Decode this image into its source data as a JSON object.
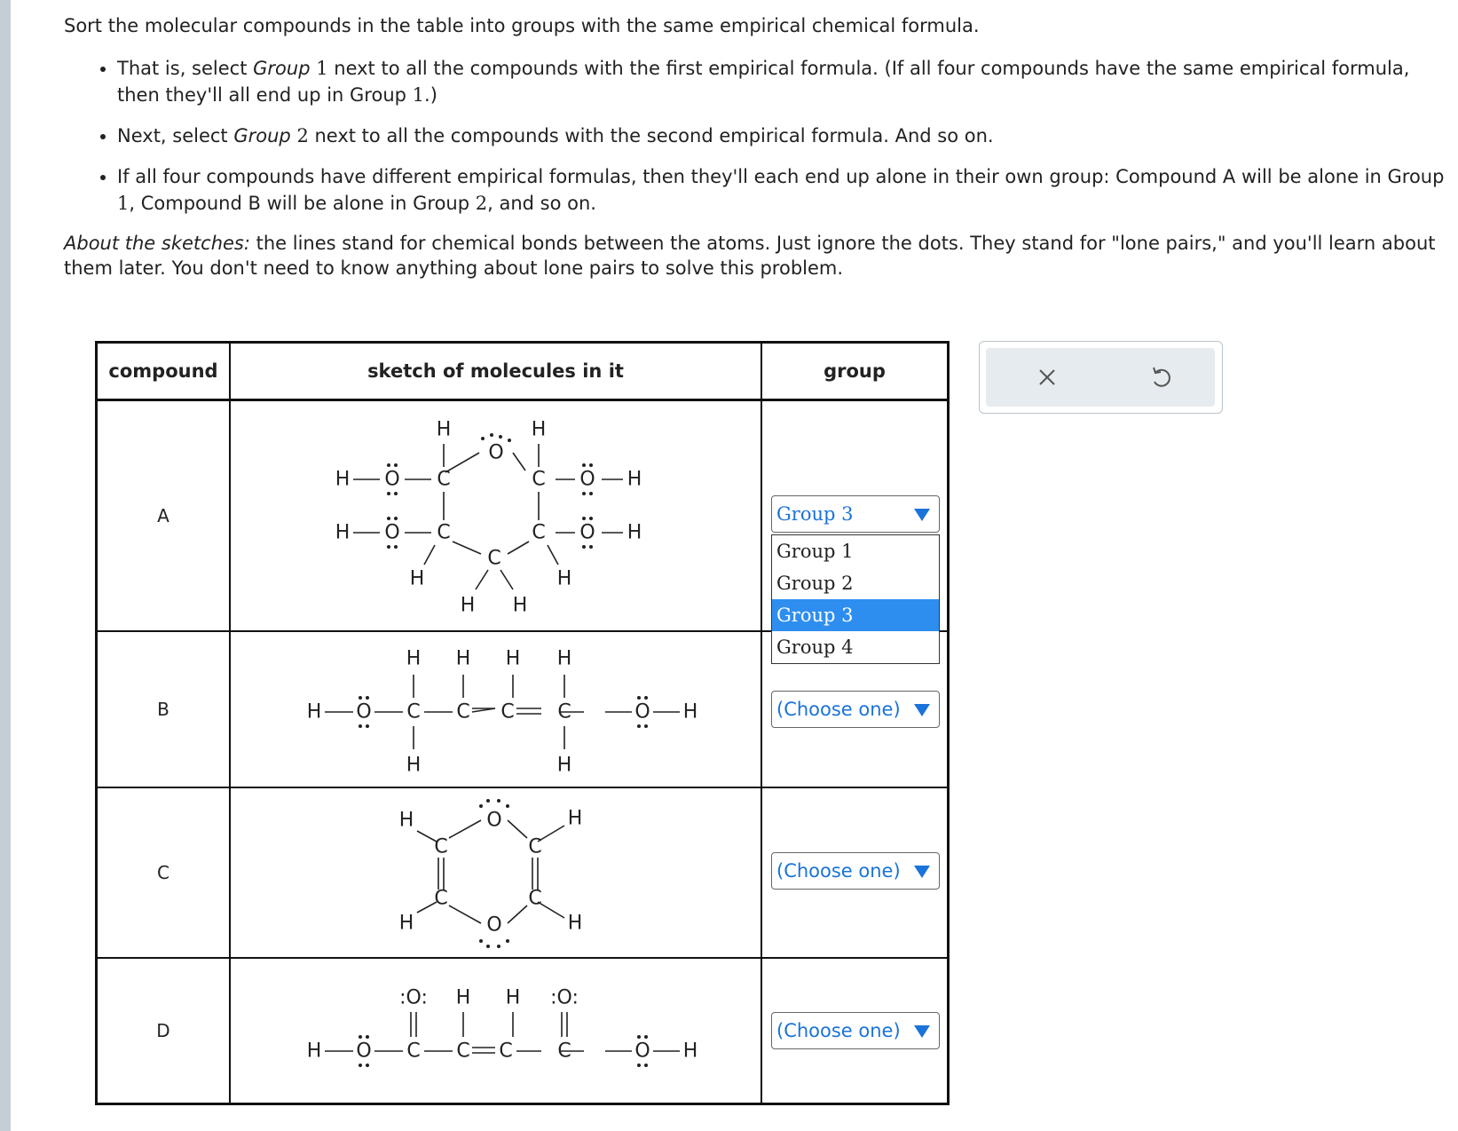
{
  "instructions": {
    "title": "Sort the molecular compounds in the table into groups with the same empirical chemical formula.",
    "bullet1_a": "That is, select ",
    "bullet1_group": "Group",
    "bullet1_num": "1",
    "bullet1_b": " next to all the compounds with the first empirical formula. (If all four compounds have the same empirical formula, then they'll all end up in Group ",
    "bullet1_num2": "1",
    "bullet1_c": ".)",
    "bullet2_a": "Next, select ",
    "bullet2_group": "Group",
    "bullet2_num": "2",
    "bullet2_b": " next to all the compounds with the second empirical formula. And so on.",
    "bullet3_a": "If all four compounds have different empirical formulas, then they'll each end up alone in their own group: Compound A will be alone in Group ",
    "bullet3_num1": "1",
    "bullet3_b": ", Compound B will be alone in Group ",
    "bullet3_num2": "2",
    "bullet3_c": ", and so on.",
    "about_label": "About the sketches:",
    "about_text": " the lines stand for chemical bonds between the atoms. Just ignore the dots. They stand for \"lone pairs,\" and you'll learn about them later. You don't need to know anything about lone pairs to solve this problem."
  },
  "table": {
    "headers": {
      "compound": "compound",
      "sketch": "sketch of molecules in it",
      "group": "group"
    },
    "rows": [
      {
        "compound": "A",
        "selected": "Group 3"
      },
      {
        "compound": "B",
        "selected": "(Choose one)"
      },
      {
        "compound": "C",
        "selected": "(Choose one)"
      },
      {
        "compound": "D",
        "selected": "(Choose one)"
      }
    ],
    "dropdown_options": [
      "Group 1",
      "Group 2",
      "Group 3",
      "Group 4"
    ],
    "active_option": "Group 3"
  },
  "atoms": {
    "H": "H",
    "C": "C",
    "O": "O",
    "dO": "Ö",
    "lpO": ":O:"
  },
  "toolbar": {
    "clear_icon": "close-icon",
    "reset_icon": "undo-icon"
  },
  "colors": {
    "accent": "#1a73d9",
    "highlight": "#2e8ef0",
    "sidebar": "#c5ced5"
  }
}
